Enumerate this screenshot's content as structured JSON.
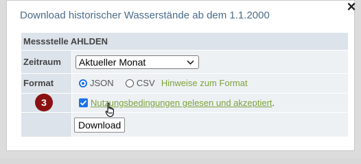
{
  "modal": {
    "title": "Download historischer Wasserstände ab dem 1.1.2000",
    "close_glyph": "×"
  },
  "form": {
    "header": "Messstelle AHLDEN",
    "zeitraum_label": "Zeitraum",
    "zeitraum_value": "Aktueller Monat",
    "format_label": "Format",
    "format_options": [
      "JSON",
      "CSV"
    ],
    "format_selected": "JSON",
    "format_hint": "Hinweise zum Format",
    "terms_link": "Nutzungsbedingungen gelesen und akzeptiert",
    "terms_suffix": ".",
    "terms_checked": true,
    "step_badge": "3",
    "download_label": "Download"
  },
  "colors": {
    "accent": "#1a73e8",
    "link": "#7ba23a",
    "badge": "#8b1111",
    "title": "#4a6b8a"
  },
  "icons": {
    "close": "close-icon",
    "dropdown": "chevron-down-icon",
    "cursor": "hand-pointer-icon"
  }
}
